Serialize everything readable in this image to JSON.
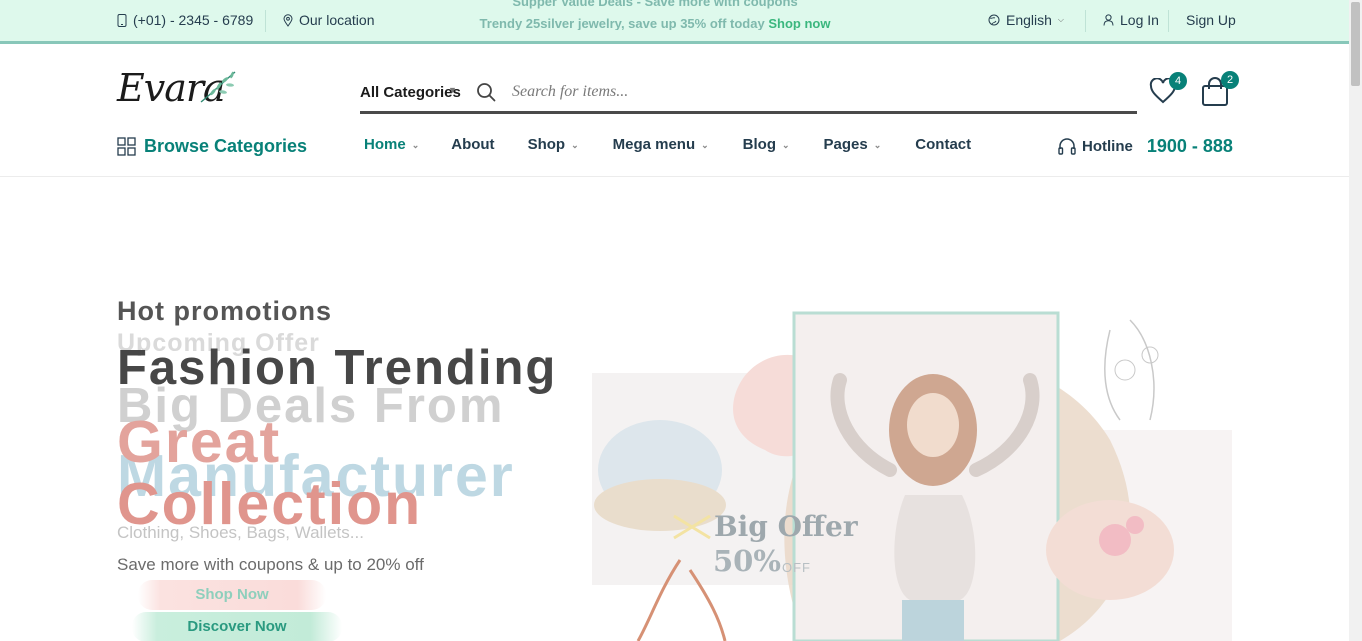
{
  "topbar": {
    "phone": "(+01) - 2345 - 6789",
    "location": "Our location",
    "ticker_line1": "Supper Value Deals - Save more with coupons",
    "ticker_line2": "Trendy 25silver jewelry, save up 35% off today",
    "ticker_link": "Shop now",
    "language": "English",
    "login": "Log In",
    "signup": "Sign Up"
  },
  "header": {
    "logo": "Evara",
    "category_select": "All Categories",
    "search_placeholder": "Search for items...",
    "wishlist_count": "4",
    "cart_count": "2"
  },
  "nav": {
    "browse": "Browse Categories",
    "items": [
      {
        "label": "Home",
        "has_dropdown": true,
        "active": true
      },
      {
        "label": "About",
        "has_dropdown": false
      },
      {
        "label": "Shop",
        "has_dropdown": true
      },
      {
        "label": "Mega menu",
        "has_dropdown": true
      },
      {
        "label": "Blog",
        "has_dropdown": true
      },
      {
        "label": "Pages",
        "has_dropdown": true
      },
      {
        "label": "Contact",
        "has_dropdown": false
      }
    ],
    "hotline_label": "Hotline",
    "hotline_number": "1900 - 888"
  },
  "hero": {
    "sub1": "Hot promotions",
    "sub2": "Upcoming Offer",
    "big1": "Fashion Trending",
    "big2": "Big Deals From",
    "big3": "Great",
    "big4": "Manufacturer",
    "big5": "Collection",
    "small1": "Clothing, Shoes, Bags, Wallets...",
    "small2": "Save more with coupons & up to 20% off",
    "shop_button": "Shop Now",
    "discover_button": "Discover Now",
    "offer_title": "Big Offer",
    "offer_value": "50%",
    "offer_suffix": "OFF"
  },
  "colors": {
    "accent": "#088178",
    "topbar_bg": "#def9ec",
    "text": "#253d4e"
  }
}
